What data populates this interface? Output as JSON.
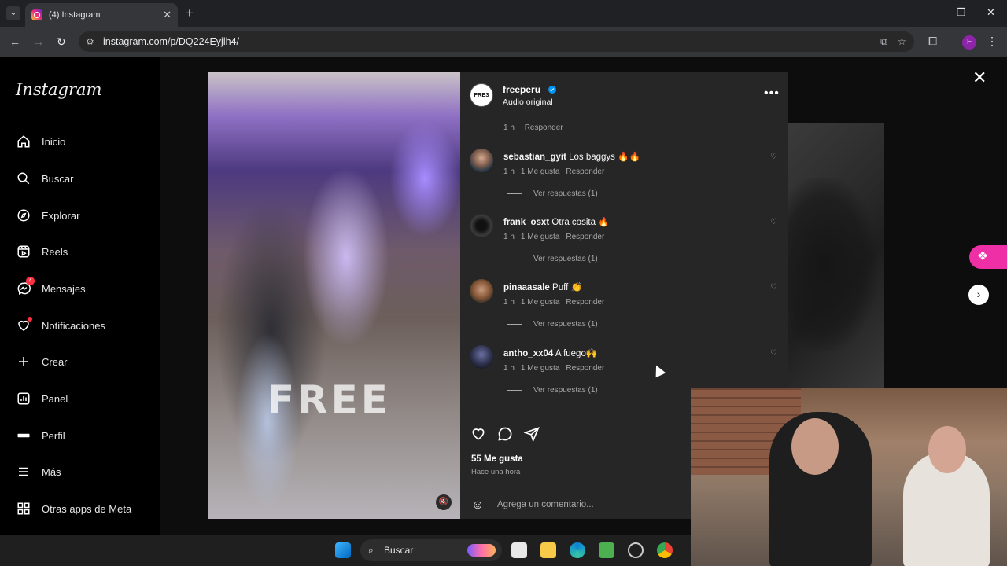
{
  "browser": {
    "tab_title": "(4) Instagram",
    "tab_close": "✕",
    "new_tab": "+",
    "url": "instagram.com/p/DQ224Eyjlh4/",
    "profile_initial": "F",
    "window": {
      "minimize": "—",
      "maximize": "❐",
      "close": "✕"
    }
  },
  "sidebar": {
    "logo": "Instagram",
    "items": [
      {
        "label": "Inicio",
        "icon": "home-icon"
      },
      {
        "label": "Buscar",
        "icon": "search-icon"
      },
      {
        "label": "Explorar",
        "icon": "compass-icon"
      },
      {
        "label": "Reels",
        "icon": "reels-icon"
      },
      {
        "label": "Mensajes",
        "icon": "messenger-icon",
        "badge": "4"
      },
      {
        "label": "Notificaciones",
        "icon": "heart-icon"
      },
      {
        "label": "Crear",
        "icon": "plus-icon"
      },
      {
        "label": "Panel",
        "icon": "chart-icon"
      },
      {
        "label": "Perfil",
        "icon": "profile-icon"
      },
      {
        "label": "Más",
        "icon": "menu-icon"
      },
      {
        "label": "Otras apps de Meta",
        "icon": "meta-apps-icon"
      }
    ]
  },
  "post": {
    "video_watermark": "FREE",
    "username": "freeperu_",
    "avatar_text": "FRE3",
    "subtitle": "Audio original",
    "top_meta": {
      "time": "1 h",
      "reply": "Responder"
    },
    "comments": [
      {
        "user": "sebastian_gyit",
        "text": "Los baggys 🔥🔥",
        "time": "1 h",
        "likes": "1 Me gusta",
        "reply": "Responder",
        "view_replies": "Ver respuestas (1)"
      },
      {
        "user": "frank_osxt",
        "text": "Otra cosita 🔥",
        "time": "1 h",
        "likes": "1 Me gusta",
        "reply": "Responder",
        "view_replies": "Ver respuestas (1)"
      },
      {
        "user": "pinaaasale",
        "text": "Puff 👏",
        "time": "1 h",
        "likes": "1 Me gusta",
        "reply": "Responder",
        "view_replies": "Ver respuestas (1)"
      },
      {
        "user": "antho_xx04",
        "text": "A fuego🙌",
        "time": "1 h",
        "likes": "1 Me gusta",
        "reply": "Responder",
        "view_replies": "Ver respuestas (1)"
      }
    ],
    "likes_count": "55 Me gusta",
    "posted_time": "Hace una hora",
    "add_comment_placeholder": "Agrega un comentario..."
  },
  "taskbar": {
    "search_label": "Buscar"
  },
  "colors": {
    "accent": "#0095f6",
    "notification": "#ff3040",
    "panel_bg": "#262626"
  }
}
